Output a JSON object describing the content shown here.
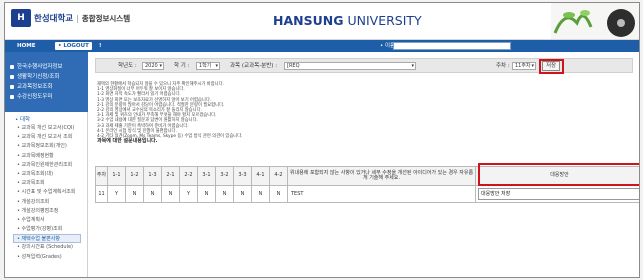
{
  "header": {
    "logo_mark": "H",
    "university_ko": "한성대학교",
    "separator": "|",
    "system_name": "종합정보시스템",
    "brand_bold": "HANSUNG",
    "brand_light": " UNIVERSITY"
  },
  "topbar": {
    "home": "HOME",
    "logout": "• LOGOUT",
    "pager": "!",
    "search_label": "• 이름"
  },
  "sidebar": {
    "quick": [
      "한국수행사업자정보",
      "생활학기신청/조회",
      "교과목정보조회",
      "수강신청도우미"
    ],
    "section_title": "• 대학",
    "items": [
      "• 교과목 개선 보고서(CQI)",
      "• 교과목 개선 보고서 조회",
      "• 교과목정보조회(개인)",
      "• 교과목배정현황",
      "• 교과목인원제한관리조회",
      "• 교과목조회(대)",
      "• 교과목조회",
      "• 시간표 및 수업계획서조회",
      "• 개설강의조회",
      "• 개설강의평점조정",
      "• 수업계획서",
      "• 수업평가(강평)조회",
      "• 재택수업 불편사항",
      "• 강의시간표 (Schedule)",
      "• 성적입력(Grades)"
    ],
    "active_index": 12
  },
  "filter": {
    "year_label": "학년도 :",
    "year_value": "2020",
    "term_label": "학 기 :",
    "term_value": "1학기",
    "course_label": "과목 (교과목-분반) :",
    "course_value": "[REQ",
    "week_label": "주차 :",
    "week_value": "11주차",
    "save": "저장"
  },
  "notes": [
    "재택의 현황에서 학습되지 않을 수 있으니 자주 확인해주시기 바랍니다.",
    "1-1 영상화질이 너무 어두워 잘 보이지 않습니다.",
    "1-2 화면 자막 속도가 빨라서 읽기 어렵습니다.",
    "1-3 영상 화면 또는 보조자료가 선명하지 않아 보기 어렵습니다.",
    "2-1 강의 분량이 많아서 감당이 어렵습니다. 적절한 분량이 필요합니다.",
    "2-2 강의 영상에서 교수님의 목소리가 잘 들리지 않습니다.",
    "3-1 과제 및 퀴즈의 안내가 부족해 무엇을 해야 할지 모르겠습니다.",
    "3-2 수업 내용에 대한 질문과 답변이 원활하지 않습니다.",
    "3-3 과제 제출 기한이 촉박하여 준비가 어렵습니다.",
    "4-1 온라인 시험 방식 및 진행이 불편합니다.",
    "4-2 기타 의견(Zoom, Ms Teams, Skype 등) 수업 방식 관련 의견이 있습니다."
  ],
  "notes_title": "과목에 대한 설문내용입니다.",
  "table": {
    "headers": [
      "주차",
      "1-1",
      "1-2",
      "1-3",
      "2-1",
      "2-2",
      "3-1",
      "3-2",
      "3-3",
      "4-1",
      "4-2"
    ],
    "free_header": "위내용에 포함되지 않는 사항이 있거나 세부 수정을 개선된 아이디어가 있는 경우 자유롭게 기술해 주세요.",
    "plan_header": "대응방안",
    "row": {
      "week": "11",
      "values": [
        "Y",
        "N",
        "N",
        "N",
        "Y",
        "N",
        "N",
        "N",
        "N",
        "N"
      ],
      "free_text": "TEST",
      "plan_text": "대응방안 저장"
    }
  }
}
